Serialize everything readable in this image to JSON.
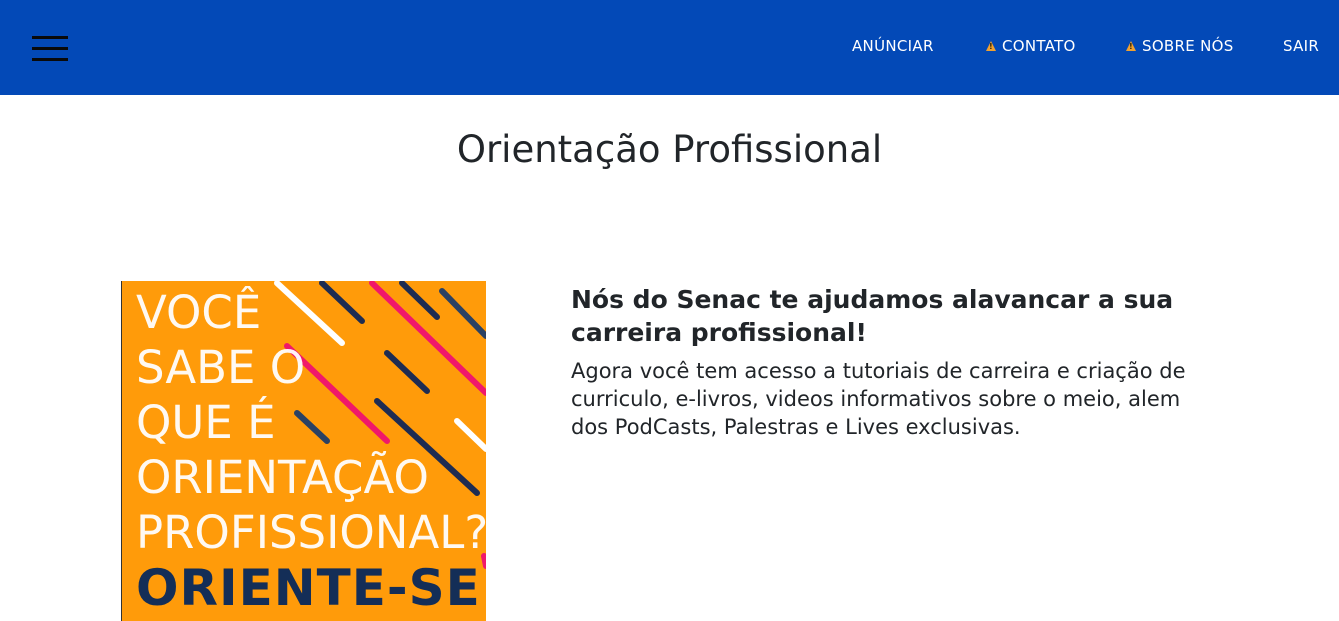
{
  "navbar": {
    "background": "#0349b7",
    "menu_icon": "hamburger-menu-icon",
    "links": [
      {
        "label": "ANÚNCIAR",
        "icon": null
      },
      {
        "label": "CONTATO",
        "icon": "warning-icon"
      },
      {
        "label": "SOBRE NÓS",
        "icon": "warning-icon"
      },
      {
        "label": "SAIR",
        "icon": null
      }
    ]
  },
  "main": {
    "title": "Orientação Profissional",
    "poster": {
      "background": "#ff9b0a",
      "lines": [
        "VOCÊ",
        "SABE O",
        "QUE É",
        "ORIENTAÇÃO",
        "PROFISSIONAL?"
      ],
      "cta": "ORIENTE-SE!"
    },
    "heading": "Nós do Senac te ajudamos alavancar a sua carreira profissional!",
    "body": "Agora você tem acesso a tutoriais de carreira e criação de curriculo, e-livros, videos informativos sobre o meio, alem dos PodCasts, Palestras e Lives exclusivas."
  }
}
